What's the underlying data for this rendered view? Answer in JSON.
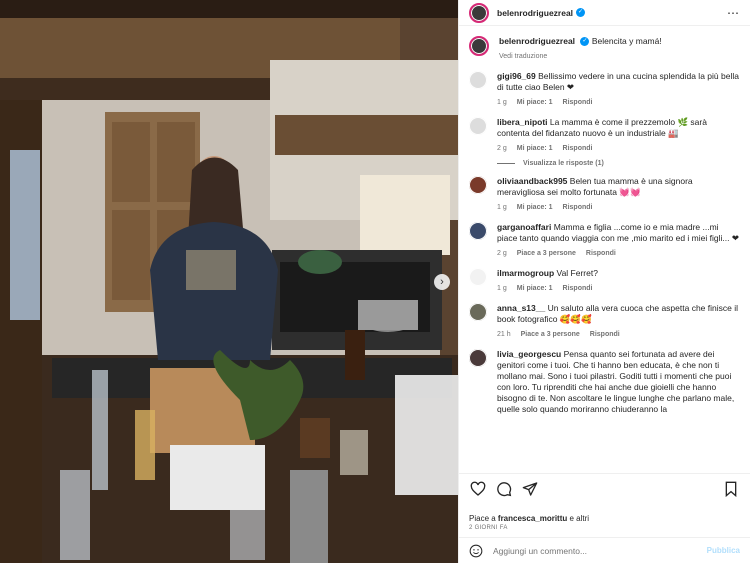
{
  "post": {
    "username": "belenrodriguezreal",
    "caption": "Belencita y mamá!",
    "see_translation": "Vedi traduzione",
    "likes_text_prefix": "Piace a ",
    "likes_user": "francesca_morittu",
    "likes_suffix": " e altri",
    "date": "2 giorni fa"
  },
  "comments": [
    {
      "user": "gigi96_69",
      "text": "Bellissimo vedere in una cucina splendida la più bella di tutte ciao Belen ❤",
      "time": "1 g",
      "likes": "Mi piace: 1",
      "reply": "Rispondi"
    },
    {
      "user": "libera_nipoti",
      "text": "La mamma è come il prezzemolo 🌿 sarà contenta del fidanzato nuovo è un industriale 🏭",
      "time": "2 g",
      "likes": "Mi piace: 1",
      "reply": "Rispondi"
    },
    {
      "user": "oliviaandback995",
      "text": "Belen tua mamma è una signora meravigliosa sei molto fortunata 💓💓",
      "time": "1 g",
      "likes": "Mi piace: 1",
      "reply": "Rispondi"
    },
    {
      "user": "garganoaffari",
      "text": "Mamma e figlia ...come io e mia madre ...mi piace tanto quando viaggia con me ,mio marito ed i miei figli... ❤",
      "time": "2 g",
      "likes": "Piace a 3 persone",
      "reply": "Rispondi"
    },
    {
      "user": "ilmarmogroup",
      "text": "Val Ferret?",
      "time": "1 g",
      "likes": "Mi piace: 1",
      "reply": "Rispondi"
    },
    {
      "user": "anna_s13__",
      "text": "Un saluto alla vera cuoca che aspetta che finisce il book fotografico 🥰🥰🥰",
      "time": "21 h",
      "likes": "Piace a 3 persone",
      "reply": "Rispondi"
    },
    {
      "user": "livia_georgescu",
      "text": "Pensa quanto sei fortunata ad avere dei genitori come i tuoi. Che ti hanno ben educata, è che non ti mollano mai. Sono i tuoi pilastri. Goditi tutti i momenti che puoi con loro. Tu riprenditi che hai anche due gioielli che hanno bisogno di te. Non ascoltare le lingue lunghe che parlano male, quelle solo quando moriranno chiuderanno la",
      "time": "",
      "likes": "",
      "reply": ""
    }
  ],
  "view_replies": "Visualizza le risposte (1)",
  "add_comment": {
    "placeholder": "Aggiungi un commento...",
    "publish": "Pubblica"
  },
  "icons": [
    "more-icon",
    "heart-icon",
    "comment-icon",
    "share-icon",
    "bookmark-icon",
    "emoji-icon",
    "chevron-right-icon"
  ]
}
